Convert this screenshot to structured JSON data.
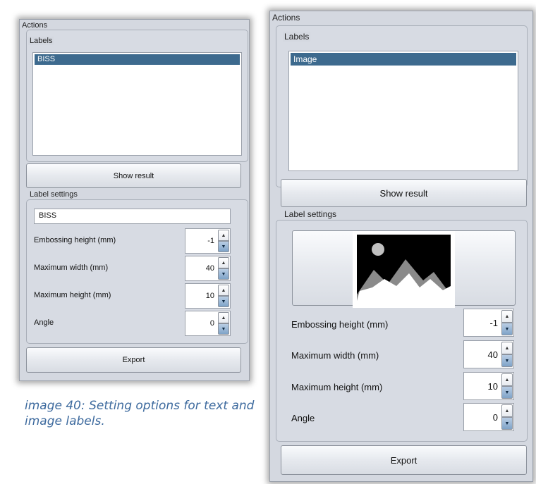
{
  "left_panel": {
    "title": "Actions",
    "labels_group": "Labels",
    "list_items": [
      "BISS"
    ],
    "show_result_label": "Show result",
    "label_settings_group": "Label settings",
    "text_value": "BISS",
    "fields": [
      {
        "label": "Embossing height (mm)",
        "value": "-1"
      },
      {
        "label": "Maximum width (mm)",
        "value": "40"
      },
      {
        "label": "Maximum height (mm)",
        "value": "10"
      },
      {
        "label": "Angle",
        "value": "0"
      }
    ],
    "export_label": "Export"
  },
  "right_panel": {
    "title": "Actions",
    "labels_group": "Labels",
    "list_items": [
      "Image"
    ],
    "show_result_label": "Show result",
    "label_settings_group": "Label settings",
    "image_icon": "image-placeholder-icon",
    "fields": [
      {
        "label": "Embossing height (mm)",
        "value": "-1"
      },
      {
        "label": "Maximum width (mm)",
        "value": "40"
      },
      {
        "label": "Maximum height (mm)",
        "value": "10"
      },
      {
        "label": "Angle",
        "value": "0"
      }
    ],
    "export_label": "Export"
  },
  "caption": "image 40: Setting options for text and image labels.",
  "colors": {
    "selection": "#3d6a8e",
    "panel": "#d4d8e0",
    "caption": "#3d6a9e",
    "spin_down": "#7fa3c8"
  }
}
